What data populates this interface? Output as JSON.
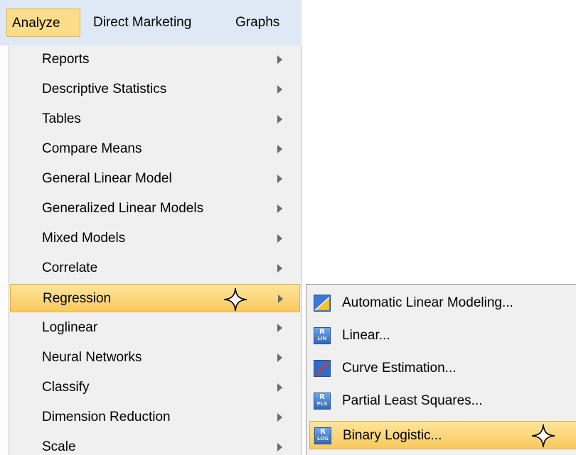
{
  "menubar": {
    "items": [
      {
        "label": "Analyze"
      },
      {
        "label": "Direct Marketing"
      },
      {
        "label": "Graphs"
      }
    ]
  },
  "dropdown": {
    "items": [
      {
        "label": "Reports"
      },
      {
        "label": "Descriptive Statistics"
      },
      {
        "label": "Tables"
      },
      {
        "label": "Compare Means"
      },
      {
        "label": "General Linear Model"
      },
      {
        "label": "Generalized Linear Models"
      },
      {
        "label": "Mixed Models"
      },
      {
        "label": "Correlate"
      },
      {
        "label": "Regression"
      },
      {
        "label": "Loglinear"
      },
      {
        "label": "Neural Networks"
      },
      {
        "label": "Classify"
      },
      {
        "label": "Dimension Reduction"
      },
      {
        "label": "Scale"
      }
    ],
    "highlighted": "Regression"
  },
  "submenu": {
    "items": [
      {
        "label": "Automatic Linear Modeling...",
        "icon": "automatic-linear-modeling-icon"
      },
      {
        "label": "Linear...",
        "icon": "linear-regression-icon",
        "icon_text": "R",
        "icon_sub": "LIN"
      },
      {
        "label": "Curve Estimation...",
        "icon": "curve-estimation-icon"
      },
      {
        "label": "Partial Least Squares...",
        "icon": "partial-least-squares-icon",
        "icon_text": "R",
        "icon_sub": "PLS"
      },
      {
        "label": "Binary Logistic...",
        "icon": "binary-logistic-icon",
        "icon_text": "R",
        "icon_sub": "LOG"
      }
    ],
    "highlighted": "Binary Logistic..."
  },
  "colors": {
    "highlight": "#f9c95e",
    "menubar_bg": "#dfe9f5",
    "menu_bg": "#f0f0f0"
  }
}
